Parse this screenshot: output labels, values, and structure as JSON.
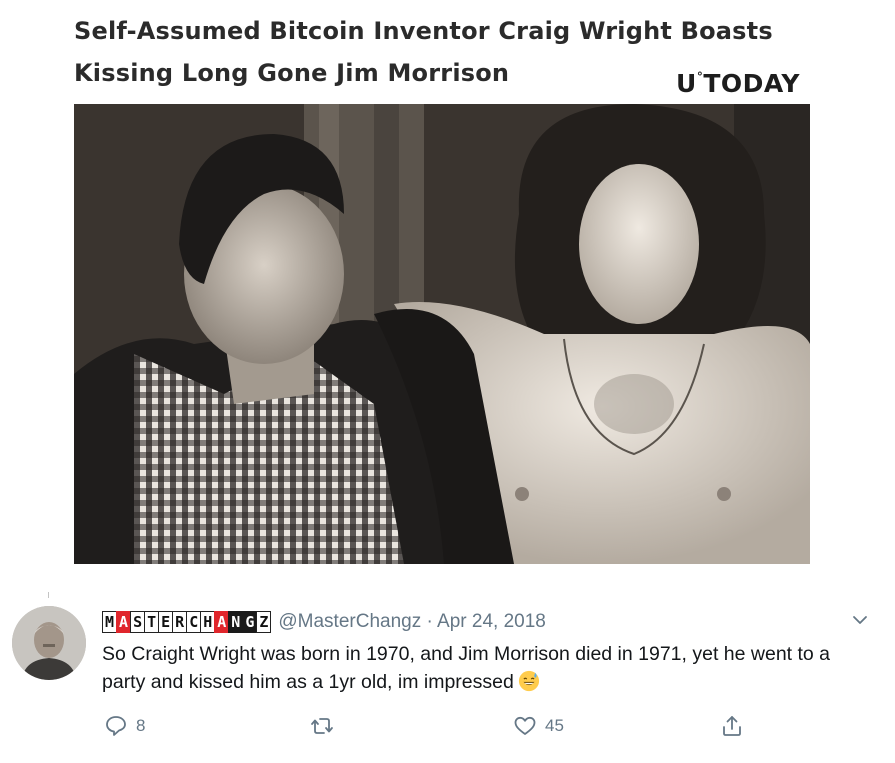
{
  "article": {
    "headline": "Self-Assumed Bitcoin Inventor Craig Wright Boasts Kissing Long Gone Jim Morrison",
    "brand_u": "U",
    "brand_deg": "°",
    "brand_rest": "TODAY"
  },
  "tweet": {
    "display_name_letters": [
      "M",
      "A",
      "S",
      "T",
      "E",
      "R",
      "C",
      "H",
      "A",
      "N",
      "G",
      "Z"
    ],
    "handle_date": "@MasterChangz · Apr 24, 2018",
    "text": "So Craight Wright was born in 1970, and Jim Morrison died in 1971, yet he went to a party and kissed him as a 1yr old, im impressed",
    "emoji": "grinning-sweat-emoji",
    "actions": {
      "reply_count": "8",
      "retweet_count": "",
      "like_count": "45"
    }
  },
  "icons": {
    "reply": "reply-icon",
    "retweet": "retweet-icon",
    "like": "heart-icon",
    "share": "share-icon",
    "menu": "chevron-down-icon"
  },
  "colors": {
    "brand_red": "#e0262c",
    "twitter_gray": "#657786",
    "text": "#14171a"
  }
}
